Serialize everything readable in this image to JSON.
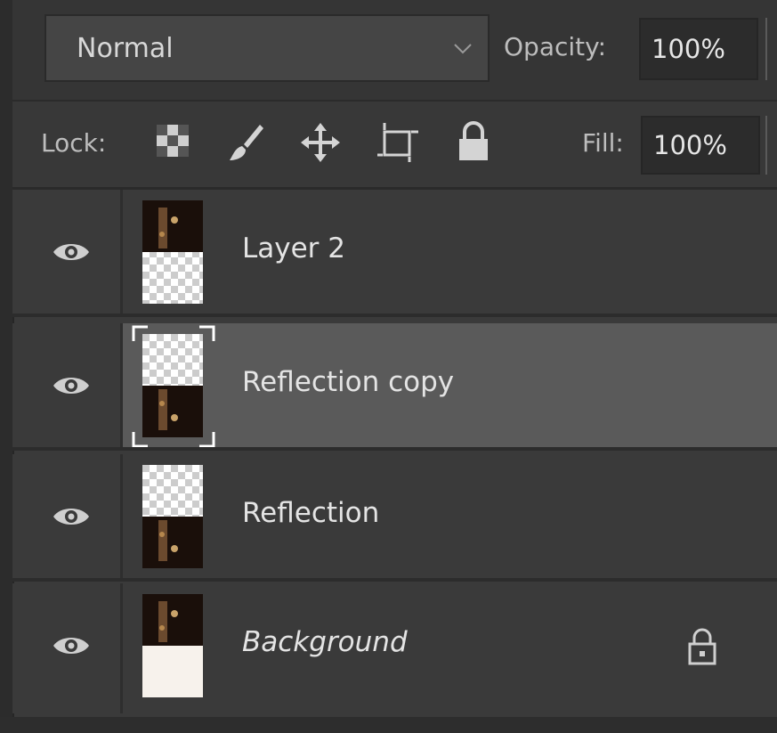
{
  "blend_mode": {
    "value": "Normal"
  },
  "opacity": {
    "label": "Opacity:",
    "value": "100%"
  },
  "lock": {
    "label": "Lock:",
    "icons": [
      "lock-transparent-pixels-icon",
      "lock-image-pixels-icon",
      "lock-position-icon",
      "lock-artboard-icon",
      "lock-all-icon"
    ]
  },
  "fill": {
    "label": "Fill:",
    "value": "100%"
  },
  "layers": [
    {
      "name": "Layer 2",
      "visible": true,
      "selected": false,
      "thumb": "image-top-transparent-bottom"
    },
    {
      "name": "Reflection copy",
      "visible": true,
      "selected": true,
      "thumb": "transparent-top-image-bottom"
    },
    {
      "name": "Reflection",
      "visible": true,
      "selected": false,
      "thumb": "transparent-top-image-bottom"
    },
    {
      "name": "Background",
      "visible": true,
      "selected": false,
      "locked": true,
      "thumb": "image-top-white-bottom"
    }
  ],
  "colors": {
    "panel": "#3a3a3a",
    "selected": "#5a5a5a",
    "text": "#e4e4e4"
  }
}
